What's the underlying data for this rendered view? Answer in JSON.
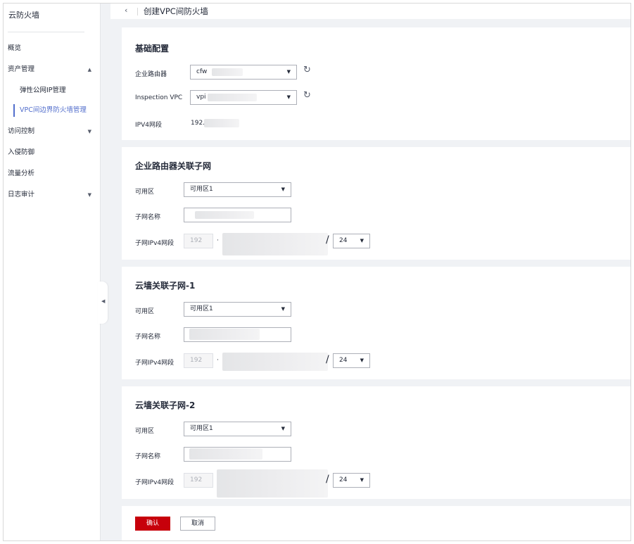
{
  "sidebar": {
    "title": "云防火墙",
    "items": [
      {
        "label": "概览"
      },
      {
        "label": "资产管理",
        "arrow": "▲"
      },
      {
        "label": "访问控制",
        "arrow": "▼"
      },
      {
        "label": "入侵防御"
      },
      {
        "label": "流量分析"
      },
      {
        "label": "日志审计",
        "arrow": "▼"
      }
    ],
    "sub_items": [
      {
        "label": "弹性公网IP管理"
      },
      {
        "label": "VPC间边界防火墙管理"
      }
    ]
  },
  "header": {
    "back_icon": "‹",
    "title": "创建VPC间防火墙"
  },
  "basic": {
    "title": "基础配置",
    "router_label": "企业路由器",
    "router_value": "cfw",
    "inspection_label": "Inspection VPC",
    "inspection_value": "vpi",
    "ipv4_label": "IPV4网段",
    "ipv4_value": "192."
  },
  "sections": [
    {
      "title": "企业路由器关联子网",
      "az_label": "可用区",
      "az_value": "可用区1",
      "subnet_label": "子网名称",
      "cidr_label": "子网IPv4网段",
      "cidr_prefix": "192",
      "mask": "24"
    },
    {
      "title": "云墙关联子网-1",
      "az_label": "可用区",
      "az_value": "可用区1",
      "subnet_label": "子网名称",
      "cidr_label": "子网IPv4网段",
      "cidr_prefix": "192",
      "mask": "24"
    },
    {
      "title": "云墙关联子网-2",
      "az_label": "可用区",
      "az_value": "可用区1",
      "subnet_label": "子网名称",
      "cidr_label": "子网IPv4网段",
      "cidr_prefix": "192",
      "mask": "24"
    }
  ],
  "footer": {
    "confirm_label": "确认",
    "cancel_label": "取消"
  },
  "symbols": {
    "caret": "▼",
    "refresh": "↻",
    "dot": "·",
    "slash": "/",
    "collapse": "◀"
  },
  "colors": {
    "primary": "#c7000b",
    "link": "#526ecc",
    "page_bg": "#f0f2f5"
  }
}
